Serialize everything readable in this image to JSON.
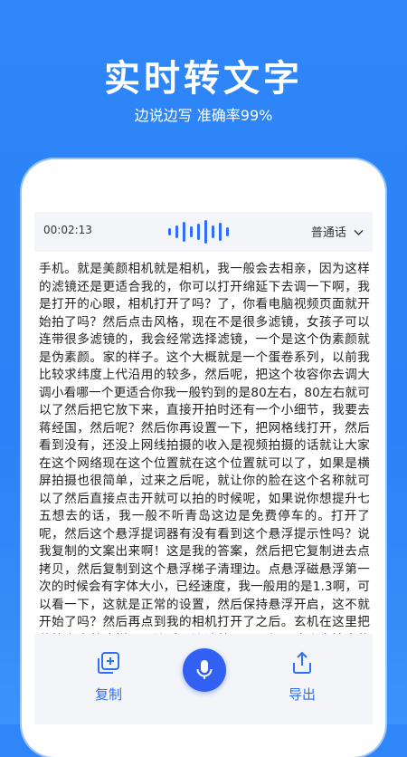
{
  "hero": {
    "title": "实时转文字",
    "subtitle": "边说边写 准确率99%"
  },
  "recorder": {
    "time": "00:02:13",
    "language": "普通话"
  },
  "transcript": "手机。就是美颜相机就是相机，我一般会去相亲，因为这样的滤镜还是更适合我的，你可以打开绵延下去调一下啊，我是打开的心眼，相机打开了吗？了，你看电脑视频页面就开始拍了吗？然后点击风格，现在不是很多滤镜，女孩子可以连带很多滤镜的，我会经常选择滤镜，一个是这个伪素颜就是伪素颜。家的样子。这个大概就是一个蛋卷系列，以前我比较求纬度上代沿用的较多，然后呢，把这个妆容你去调大调小看哪一个更适合你我一般钓到的是80左右，80左右就可以了然后把它放下来，直接开拍时还有一个小细节，我要去蒋经国，然后呢？然后你再设置一下，把网格线打开，然后看到没有，还没上网线拍摄的收入是视频拍摄的话就让大家在这个网络现在这个位置就在这个位置就可以了，如果是横屏拍摄也很简单，过来之后呢，就让你的脸在这个名称就可以了然后直接点击开就可以拍的时候呢，如果说你想提升七五想去的话，我一般不听青岛这边是免费停车的。打开了呢，然后这个悬浮提词器有没有看到这个悬浮提示性吗？说我复制的文案出来啊！这是我的答案，然后把它复制进去点拷贝，然后复制到这个悬浮梯子清理边。点悬浮磁悬浮第一次的时候会有字体大小，已经速度，我一般用的是1.3啊，可以看一下，这就是正常的设置，然后保持悬浮开启，这不就开始了吗？然后再点到我的相机打开了之后。玄机在这里把他拉上来就这样子一边看一边读就可以了如果这个方法真的很牛目前99%人都还不知道就是我们把生活中一些有趣的视频发给抖音注意不是发给自己就这么六弄完了减一减八减上传就可以",
  "actions": {
    "copy_label": "复制",
    "export_label": "导出"
  },
  "colors": {
    "accent": "#2f6ff5",
    "background": "#2a82f6"
  }
}
